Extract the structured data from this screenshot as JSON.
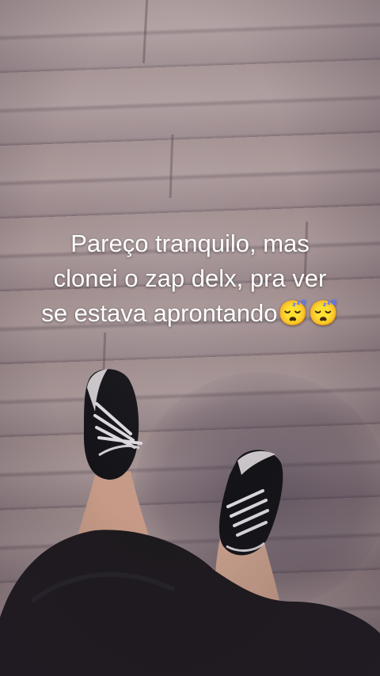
{
  "caption": {
    "line1": "Pareço tranquilo, mas",
    "line2": "clonei o zap delx, pra ver",
    "line3": "se estava aprontando😴😴"
  }
}
